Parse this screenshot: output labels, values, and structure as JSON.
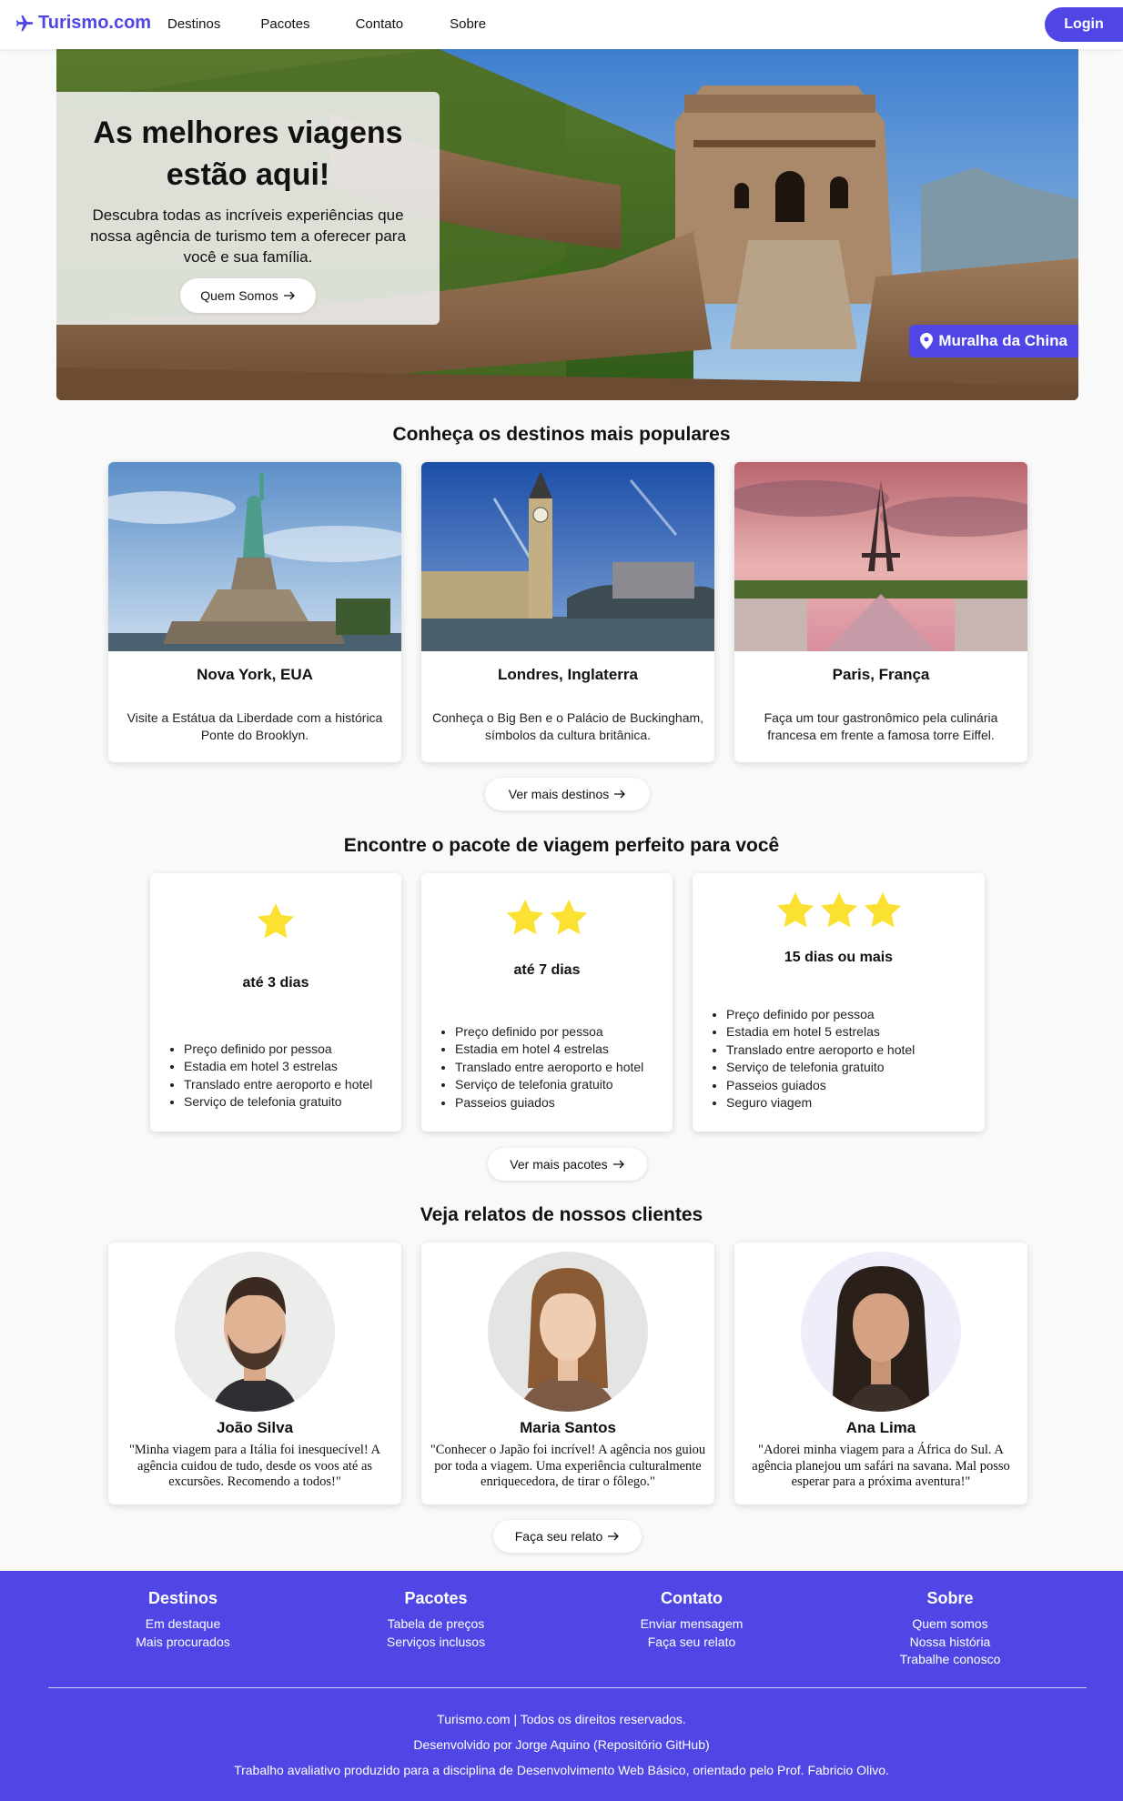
{
  "brand": {
    "name": "Turismo.com",
    "icon": "plane-icon",
    "color": "#4f46e5"
  },
  "nav": {
    "links": [
      "Destinos",
      "Pacotes",
      "Contato",
      "Sobre"
    ],
    "login": "Login"
  },
  "hero": {
    "title": "As melhores viagens estão aqui!",
    "subtitle": "Descubra todas as incríveis experiências que nossa agência de turismo tem a oferecer para você e sua família.",
    "button": "Quem Somos",
    "location_tag": "Muralha da China"
  },
  "destinations": {
    "title": "Conheça os destinos mais populares",
    "cards": [
      {
        "name": "Nova York, EUA",
        "desc": "Visite a Estátua da Liberdade com a histórica Ponte do Brooklyn."
      },
      {
        "name": "Londres, Inglaterra",
        "desc": "Conheça o Big Ben e o Palácio de Buckingham, símbolos da cultura britânica."
      },
      {
        "name": "Paris, França",
        "desc": "Faça um tour gastronômico pela culinária francesa em frente a famosa torre Eiffel."
      }
    ],
    "more_button": "Ver mais destinos"
  },
  "packages": {
    "title": "Encontre o pacote de viagem perfeito para você",
    "cards": [
      {
        "stars": 1,
        "name": "até 3 dias",
        "items": [
          "Preço definido por pessoa",
          "Estadia em hotel 3 estrelas",
          "Translado entre aeroporto e hotel",
          "Serviço de telefonia gratuito"
        ]
      },
      {
        "stars": 2,
        "name": "até 7 dias",
        "items": [
          "Preço definido por pessoa",
          "Estadia em hotel 4 estrelas",
          "Translado entre aeroporto e hotel",
          "Serviço de telefonia gratuito",
          "Passeios guiados"
        ]
      },
      {
        "stars": 3,
        "name": "15 dias ou mais",
        "items": [
          "Preço definido por pessoa",
          "Estadia em hotel 5 estrelas",
          "Translado entre aeroporto e hotel",
          "Serviço de telefonia gratuito",
          "Passeios guiados",
          "Seguro viagem"
        ]
      }
    ],
    "star_color": "#fbe232",
    "more_button": "Ver mais pacotes"
  },
  "testimonials": {
    "title": "Veja relatos de nossos clientes",
    "cards": [
      {
        "name": "João Silva",
        "text": "\"Minha viagem para a Itália foi inesquecível! A agência cuidou de tudo, desde os voos até as excursões. Recomendo a todos!\""
      },
      {
        "name": "Maria Santos",
        "text": "\"Conhecer o Japão foi incrível! A agência nos guiou por toda a viagem. Uma experiência culturalmente enriquecedora, de tirar o fôlego.\""
      },
      {
        "name": "Ana Lima",
        "text": "\"Adorei minha viagem para a África do Sul. A agência planejou um safári na savana. Mal posso esperar para a próxima aventura!\""
      }
    ],
    "more_button": "Faça seu relato"
  },
  "footer": {
    "columns": [
      {
        "title": "Destinos",
        "items": [
          "Em destaque",
          "Mais procurados"
        ]
      },
      {
        "title": "Pacotes",
        "items": [
          "Tabela de preços",
          "Serviços inclusos"
        ]
      },
      {
        "title": "Contato",
        "items": [
          "Enviar mensagem",
          "Faça seu relato"
        ]
      },
      {
        "title": "Sobre",
        "items": [
          "Quem somos",
          "Nossa história",
          "Trabalhe conosco"
        ]
      }
    ],
    "copyright": "Turismo.com | Todos os direitos reservados.",
    "developer": "Desenvolvido por Jorge Aquino (Repositório GitHub)",
    "credits": "Trabalho avaliativo produzido para a disciplina de Desenvolvimento Web Básico, orientado pelo Prof. Fabricio Olivo.",
    "background": "#4f46e5"
  }
}
